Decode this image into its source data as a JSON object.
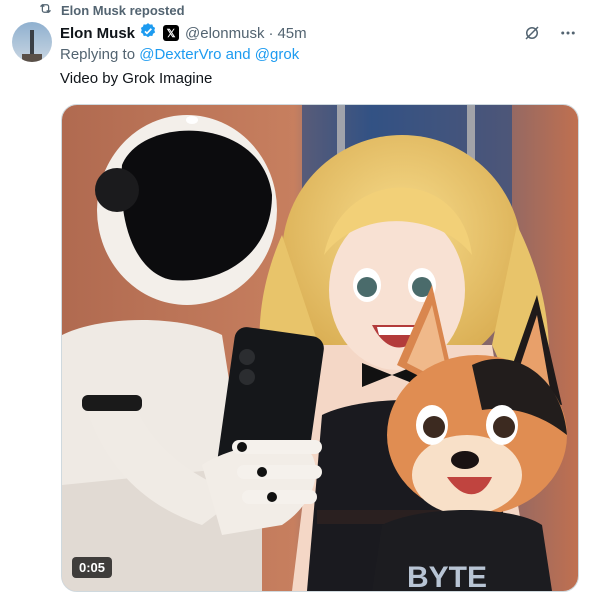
{
  "repost": {
    "label": "Elon Musk reposted",
    "icon": "repost-icon"
  },
  "author": {
    "name": "Elon Musk",
    "handle": "@elonmusk",
    "time": "45m",
    "separator": "·",
    "badge_color": "#1d9bf0"
  },
  "reply": {
    "prefix": "Replying to ",
    "user1": "@DexterVro",
    "conj": " and ",
    "user2": "@grok"
  },
  "tweet": {
    "text": "Video by Grok Imagine"
  },
  "media": {
    "duration": "0:05",
    "shirt_text": "BYTE"
  },
  "colors": {
    "accent": "#1d9bf0",
    "muted": "#536471"
  }
}
